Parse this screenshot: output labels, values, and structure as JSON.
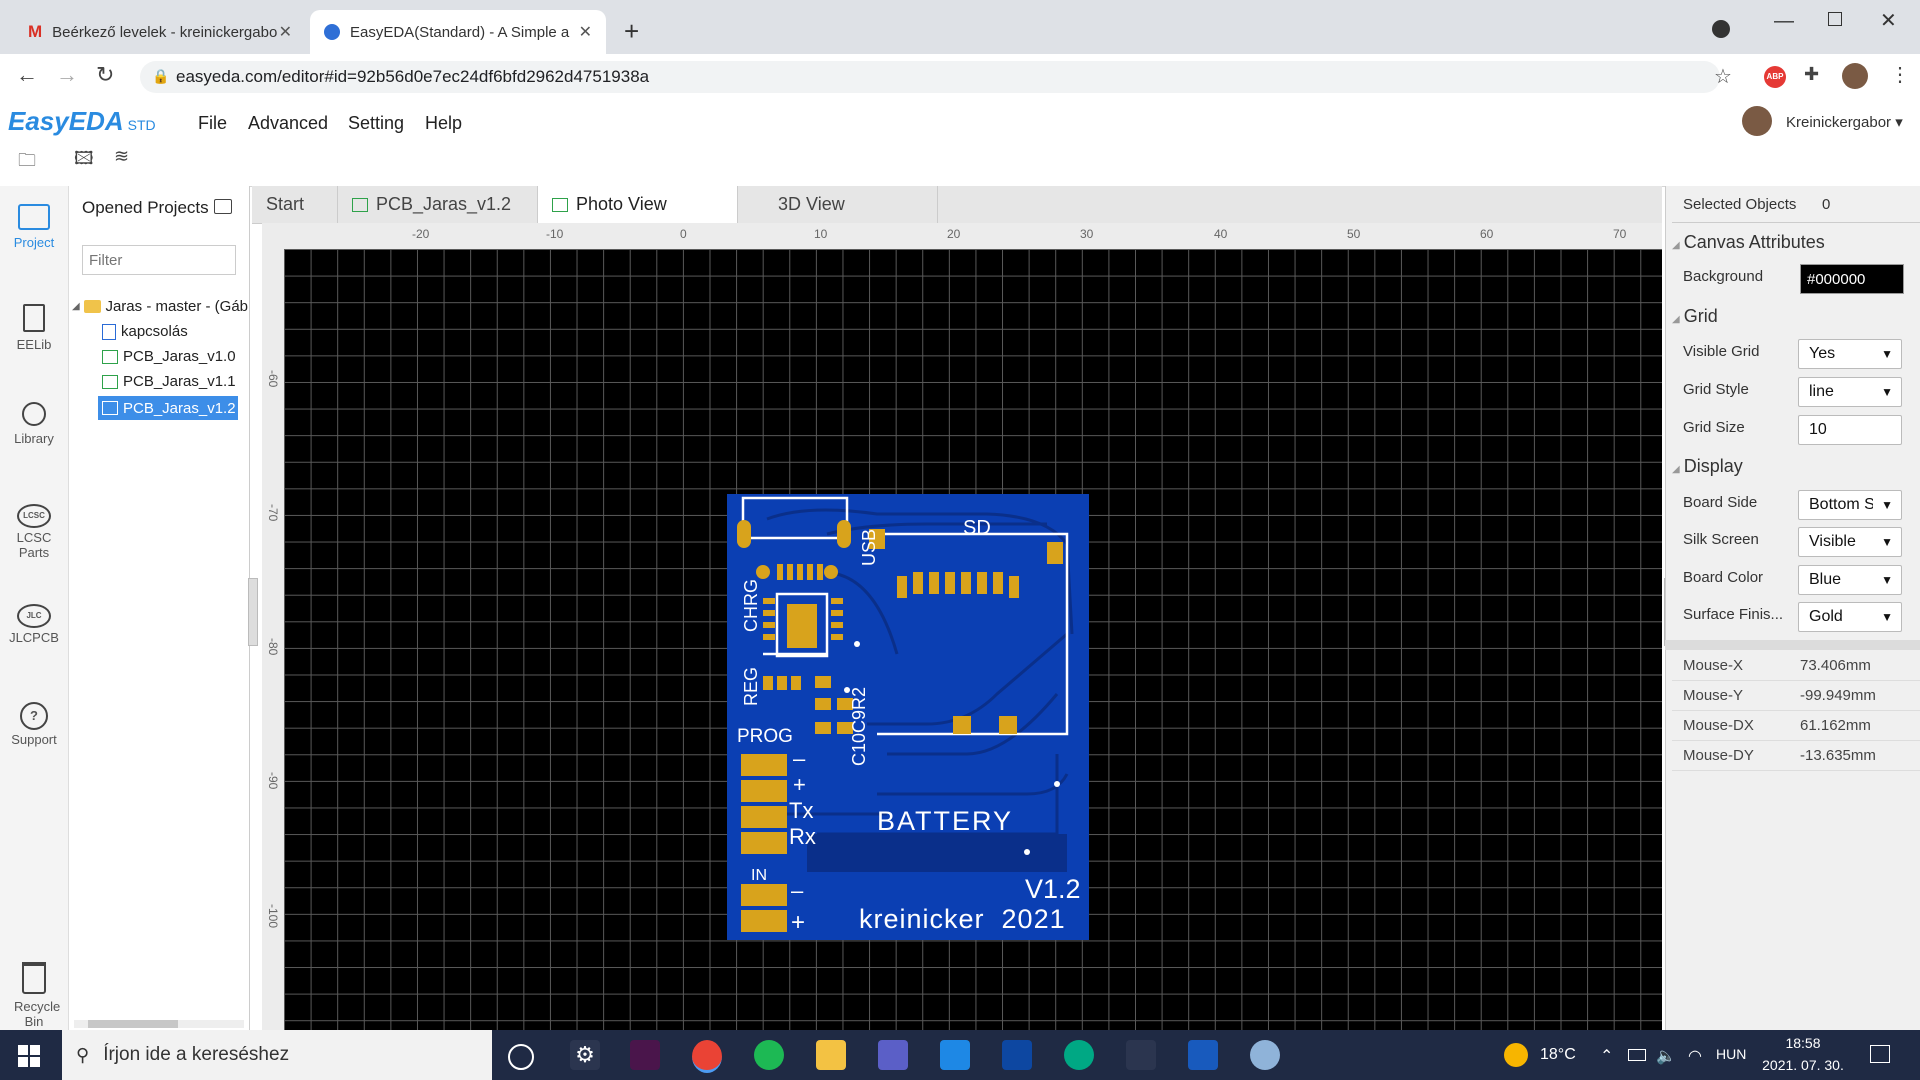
{
  "browser": {
    "tabs": [
      {
        "title": "Beérkező levelek - kreinickergabo"
      },
      {
        "title": "EasyEDA(Standard) - A Simple an"
      }
    ],
    "url": "easyeda.com/editor#id=92b56d0e7ec24df6bfd2962d4751938a"
  },
  "app": {
    "logo": "EasyEDA",
    "logo_sub": "STD",
    "menu": [
      "File",
      "Advanced",
      "Setting",
      "Help"
    ],
    "user": "Kreinickergabor"
  },
  "leftbar": [
    "Project",
    "EELib",
    "Library",
    "LCSC Parts",
    "JLCPCB",
    "Support",
    "Recycle Bin"
  ],
  "projects": {
    "title": "Opened Projects",
    "filter_placeholder": "Filter",
    "root": "Jaras - master - (Gáb",
    "items": [
      "kapcsolás",
      "PCB_Jaras_v1.0",
      "PCB_Jaras_v1.1",
      "PCB_Jaras_v1.2"
    ],
    "selected": "PCB_Jaras_v1.2"
  },
  "doc_tabs": [
    "Start",
    "PCB_Jaras_v1.2",
    "Photo View",
    "3D View"
  ],
  "active_doc_tab": "Photo View",
  "ruler": {
    "top": [
      "-20",
      "-10",
      "0",
      "10",
      "20",
      "30",
      "40",
      "50",
      "60",
      "70"
    ],
    "left": [
      "-60",
      "-70",
      "-80",
      "-90",
      "-100"
    ]
  },
  "pcb": {
    "labels": {
      "sd": "SD",
      "usb": "USB",
      "chrg": "CHRG",
      "reg": "REG",
      "prog": "PROG",
      "c10": "C10C9R2",
      "battery": "BATTERY",
      "version": "V1.2",
      "author": "kreinicker  2021",
      "minus1": "–",
      "plus1": "+",
      "tx": "Tx",
      "rx": "Rx",
      "in": "IN",
      "minus2": "–",
      "plus2": "+"
    },
    "colors": {
      "board": "#0b3fb3",
      "pad": "#d8a31c",
      "silk": "#ffffff"
    }
  },
  "right_panel": {
    "selected_label": "Selected Objects",
    "selected_count": "0",
    "canvas_attributes": "Canvas Attributes",
    "background_label": "Background",
    "background_value": "#000000",
    "grid_section": "Grid",
    "visible_grid_label": "Visible Grid",
    "visible_grid_value": "Yes",
    "grid_style_label": "Grid Style",
    "grid_style_value": "line",
    "grid_size_label": "Grid Size",
    "grid_size_value": "10",
    "display_section": "Display",
    "board_side_label": "Board Side",
    "board_side_value": "Bottom S",
    "silk_label": "Silk Screen",
    "silk_value": "Visible",
    "board_color_label": "Board Color",
    "board_color_value": "Blue",
    "surface_label": "Surface Finis...",
    "surface_value": "Gold",
    "mouse": [
      {
        "label": "Mouse-X",
        "value": "73.406mm"
      },
      {
        "label": "Mouse-Y",
        "value": "-99.949mm"
      },
      {
        "label": "Mouse-DX",
        "value": "61.162mm"
      },
      {
        "label": "Mouse-DY",
        "value": "-13.635mm"
      }
    ]
  },
  "taskbar": {
    "search_placeholder": "Írjon ide a kereséshez",
    "temp": "18°C",
    "lang": "HUN",
    "time": "18:58",
    "date": "2021. 07. 30."
  }
}
